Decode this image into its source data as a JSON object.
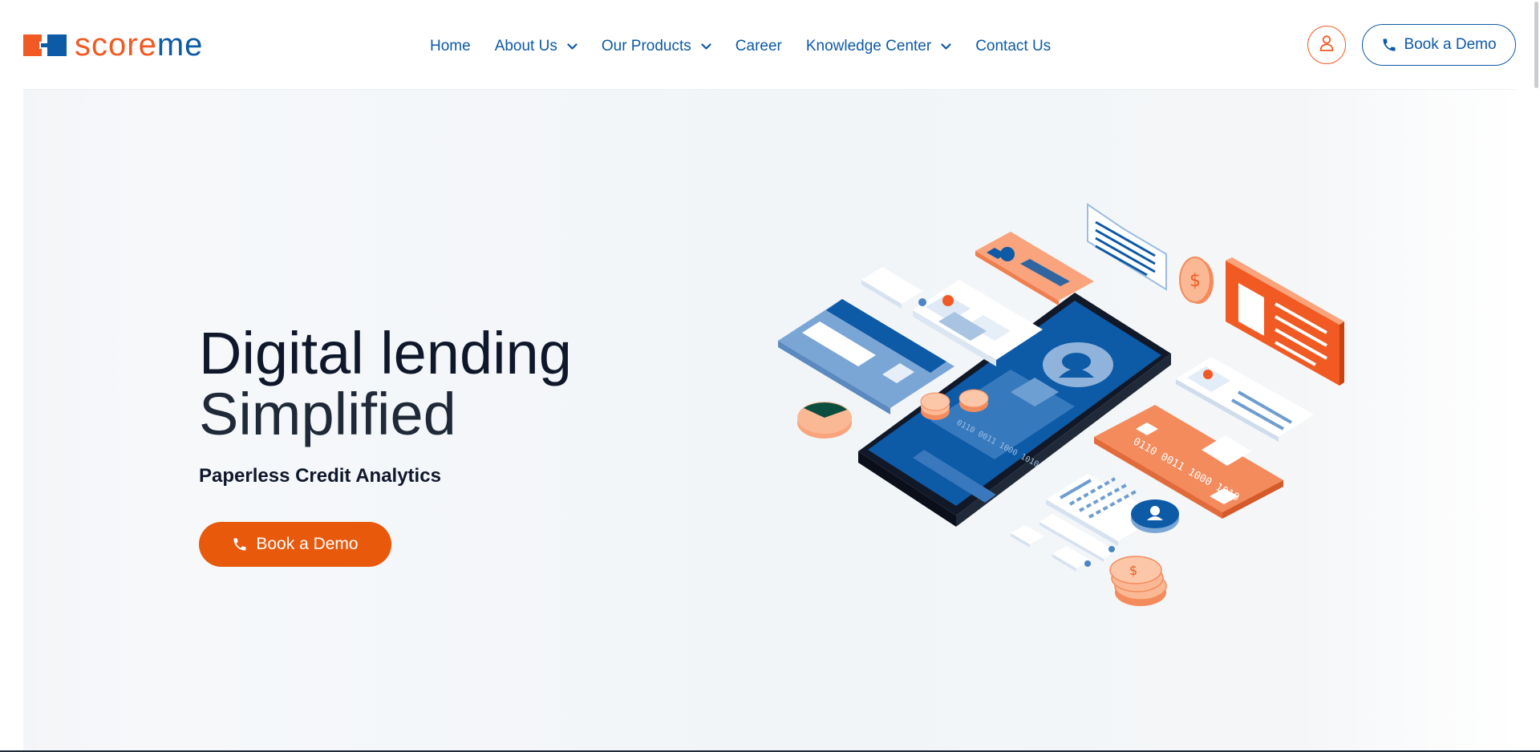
{
  "brand": {
    "logo_part1": "score",
    "logo_part2": "me",
    "accent_orange": "#f15a22",
    "accent_blue": "#0d5aa7"
  },
  "nav": {
    "items": [
      {
        "label": "Home",
        "has_dropdown": false
      },
      {
        "label": "About Us",
        "has_dropdown": true
      },
      {
        "label": "Our Products",
        "has_dropdown": true
      },
      {
        "label": "Career",
        "has_dropdown": false
      },
      {
        "label": "Knowledge Center",
        "has_dropdown": true
      },
      {
        "label": "Contact Us",
        "has_dropdown": false
      }
    ]
  },
  "header": {
    "user_icon": "user-icon",
    "demo_button_label": "Book a Demo",
    "demo_button_icon": "phone-icon"
  },
  "hero": {
    "title_line1": "Digital lending",
    "title_line2": "Simplified",
    "subtitle": "Paperless Credit Analytics",
    "cta_label": "Book a Demo",
    "cta_icon": "phone-icon",
    "card_numbers": [
      "0110 0011 1000 1010",
      "0110 0011 1000 1010"
    ]
  }
}
